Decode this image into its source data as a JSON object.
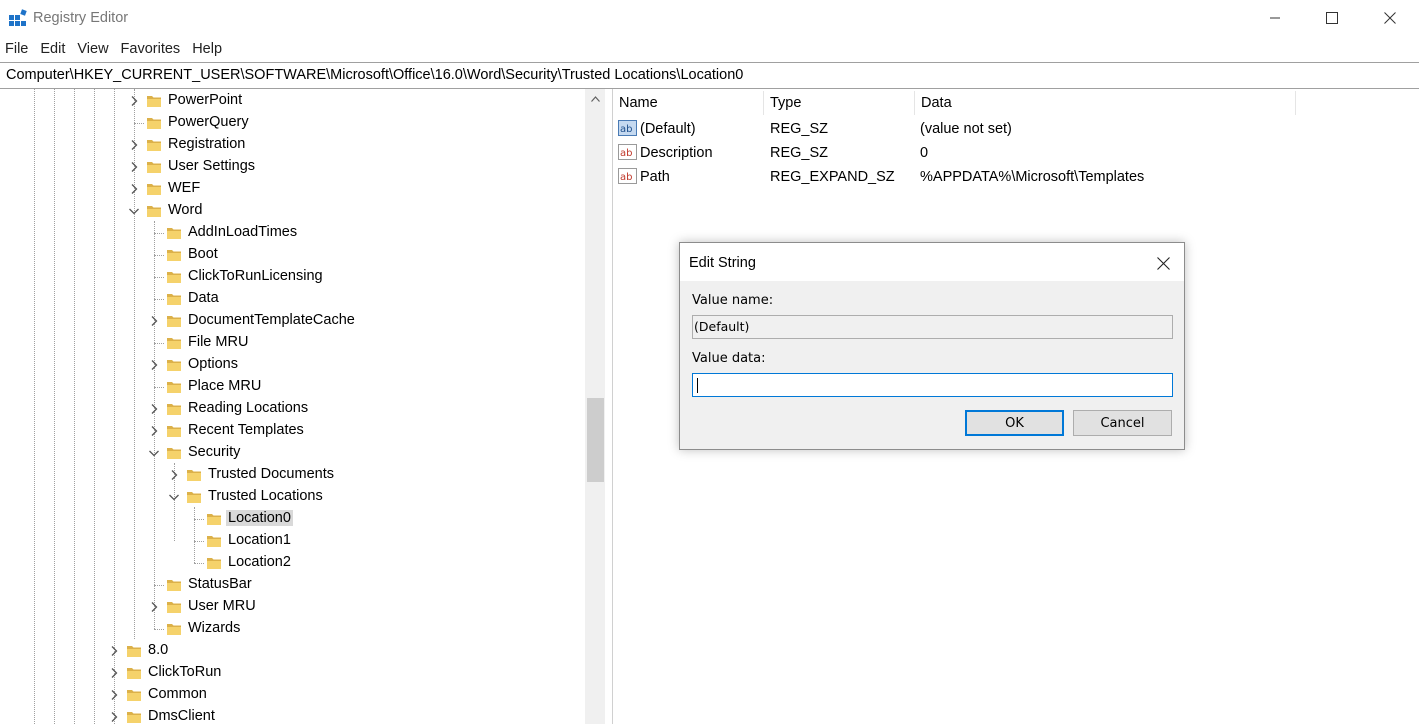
{
  "window": {
    "title": "Registry Editor",
    "icon": "registry-editor-icon",
    "controls": [
      "minimize-icon",
      "maximize-icon",
      "close-icon"
    ]
  },
  "menu": [
    "File",
    "Edit",
    "View",
    "Favorites",
    "Help"
  ],
  "address": "Computer\\HKEY_CURRENT_USER\\SOFTWARE\\Microsoft\\Office\\16.0\\Word\\Security\\Trusted Locations\\Location0",
  "tree": {
    "nodes": [
      {
        "label": "PowerPoint",
        "expander": "collapsed"
      },
      {
        "label": "PowerQuery",
        "expander": "none"
      },
      {
        "label": "Registration",
        "expander": "collapsed"
      },
      {
        "label": "User Settings",
        "expander": "collapsed"
      },
      {
        "label": "WEF",
        "expander": "collapsed"
      },
      {
        "label": "Word",
        "expander": "expanded"
      },
      {
        "label": "AddInLoadTimes",
        "expander": "none"
      },
      {
        "label": "Boot",
        "expander": "none"
      },
      {
        "label": "ClickToRunLicensing",
        "expander": "none"
      },
      {
        "label": "Data",
        "expander": "none"
      },
      {
        "label": "DocumentTemplateCache",
        "expander": "collapsed"
      },
      {
        "label": "File MRU",
        "expander": "none"
      },
      {
        "label": "Options",
        "expander": "collapsed"
      },
      {
        "label": "Place MRU",
        "expander": "none"
      },
      {
        "label": "Reading Locations",
        "expander": "collapsed"
      },
      {
        "label": "Recent Templates",
        "expander": "collapsed"
      },
      {
        "label": "Security",
        "expander": "expanded"
      },
      {
        "label": "Trusted Documents",
        "expander": "collapsed"
      },
      {
        "label": "Trusted Locations",
        "expander": "expanded"
      },
      {
        "label": "Location0",
        "expander": "none",
        "selected": true
      },
      {
        "label": "Location1",
        "expander": "none"
      },
      {
        "label": "Location2",
        "expander": "none"
      },
      {
        "label": "StatusBar",
        "expander": "none"
      },
      {
        "label": "User MRU",
        "expander": "collapsed"
      },
      {
        "label": "Wizards",
        "expander": "none"
      },
      {
        "label": "8.0",
        "expander": "collapsed"
      },
      {
        "label": "ClickToRun",
        "expander": "collapsed"
      },
      {
        "label": "Common",
        "expander": "collapsed"
      },
      {
        "label": "DmsClient",
        "expander": "collapsed"
      }
    ]
  },
  "list": {
    "columns": [
      "Name",
      "Type",
      "Data"
    ],
    "rows": [
      {
        "icon": "string-value-icon",
        "name": "(Default)",
        "type": "REG_SZ",
        "data": "(value not set)"
      },
      {
        "icon": "string-value-icon",
        "name": "Description",
        "type": "REG_SZ",
        "data": "0"
      },
      {
        "icon": "string-value-icon",
        "name": "Path",
        "type": "REG_EXPAND_SZ",
        "data": "%APPDATA%\\Microsoft\\Templates"
      }
    ]
  },
  "dialog": {
    "title": "Edit String",
    "value_name_label": "Value name:",
    "value_name": "(Default)",
    "value_data_label": "Value data:",
    "value_data": "",
    "ok_label": "OK",
    "cancel_label": "Cancel"
  },
  "colors": {
    "folder": "#f5d26b",
    "folder_dark": "#dcb14a",
    "accent": "#0078d7",
    "selection": "#d9d9d9"
  }
}
